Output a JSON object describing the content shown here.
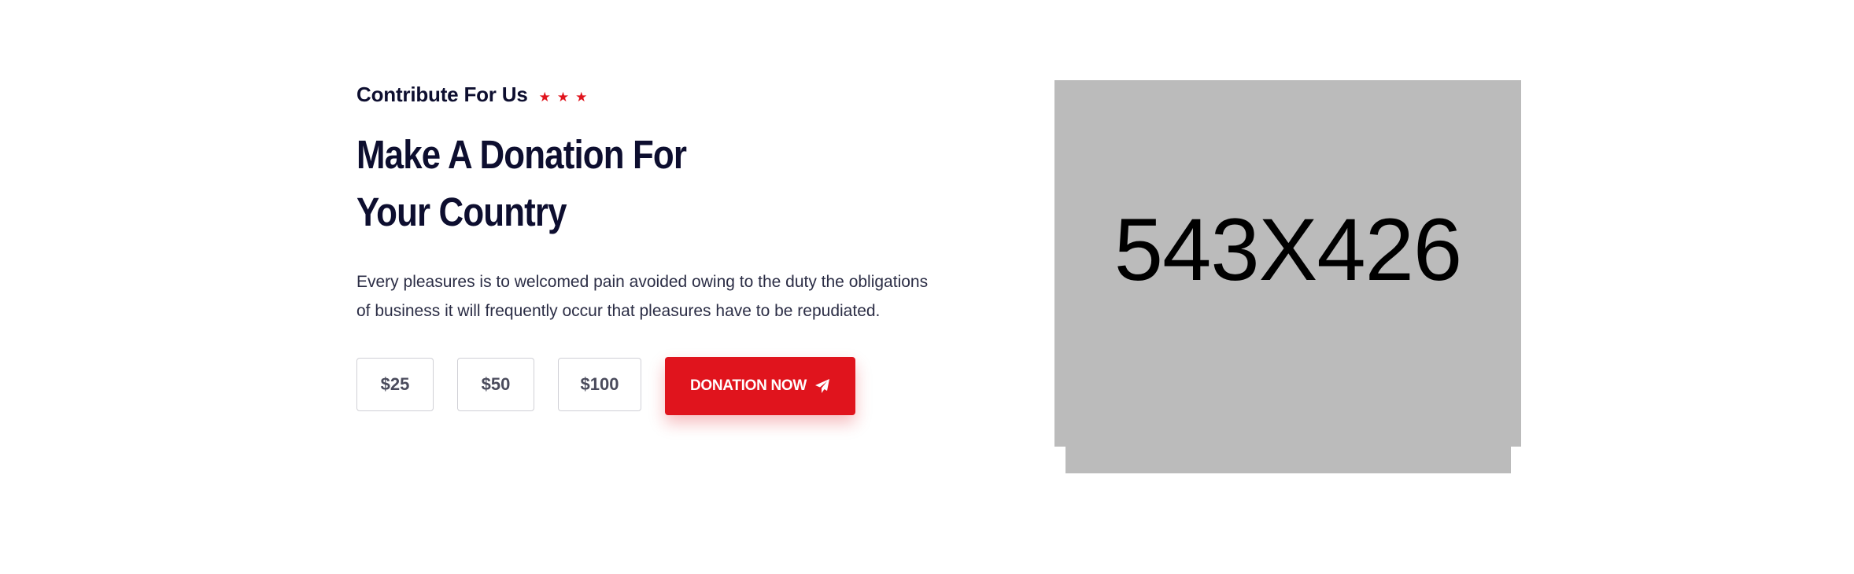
{
  "section": {
    "subtitle": "Contribute For Us",
    "stars": [
      "★",
      "★",
      "★"
    ],
    "heading_line1": "Make A Donation For",
    "heading_line2": "Your Country",
    "desc_line1": "Every pleasures is to welcomed pain avoided owing to the duty the obligations",
    "desc_line2": "of business it will frequently occur that pleasures have to be repudiated.",
    "amounts": [
      "$25",
      "$50",
      "$100"
    ],
    "donate_label": "DONATION NOW",
    "donate_icon": "paper-plane-icon"
  },
  "image": {
    "placeholder_label": "543X426"
  },
  "colors": {
    "accent": "#e0141d",
    "heading": "#0d0e2f",
    "placeholder_bg": "#bbbbbb"
  }
}
